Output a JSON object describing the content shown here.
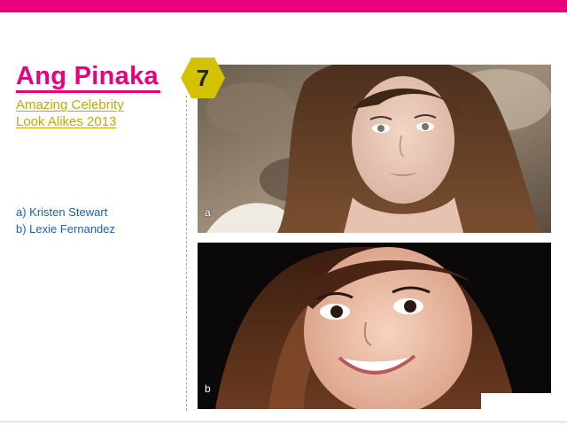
{
  "header": {
    "title": "Ang Pinaka"
  },
  "subtitle": {
    "line1": "Amazing Celebrity",
    "line2": "Look Alikes 2013"
  },
  "answers": {
    "a": "a) Kristen Stewart",
    "b": "b) Lexie Fernandez"
  },
  "badge": {
    "number": "7",
    "color": "#d4c100"
  },
  "photos": [
    {
      "label": "a",
      "subject": "Kristen Stewart"
    },
    {
      "label": "b",
      "subject": "Lexie Fernandez"
    }
  ],
  "colors": {
    "accent": "#e8007d",
    "subtitle": "#c2aa00",
    "answers": "#1f5fb0"
  }
}
